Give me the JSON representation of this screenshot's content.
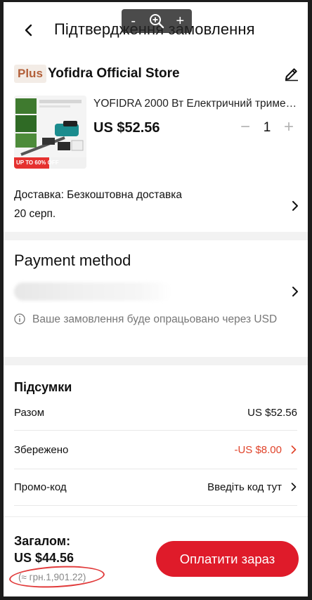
{
  "header": {
    "title": "Підтвердження замовлення",
    "zoom": {
      "zoom_out": "-",
      "zoom_in": "+"
    }
  },
  "store": {
    "badge": "Plus",
    "name": "Yofidra Official Store"
  },
  "product": {
    "title": "YOFIDRA 2000 Вт Електричний тример ...",
    "price": "US $52.56",
    "quantity": "1",
    "image_badge": "UP TO 60% OFF",
    "image_badge_highlight": "60"
  },
  "delivery": {
    "label": "Доставка: Безкоштовна доставка",
    "date": "20 серп."
  },
  "payment": {
    "title": "Payment method",
    "note": "Ваше замовлення буде опрацьовано через USD"
  },
  "summary": {
    "title": "Підсумки",
    "rows": [
      {
        "label": "Разом",
        "value": "US $52.56"
      },
      {
        "label": "Збережено",
        "value": "-US $8.00"
      },
      {
        "label": "Промо-код",
        "value": "Введіть код тут"
      }
    ]
  },
  "footer": {
    "total_label": "Загалом:",
    "total_value": "US $44.56",
    "total_uah": "(≈ грн.1,901.22)",
    "pay_button": "Оплатити зараз"
  },
  "colors": {
    "accent_red": "#df1b2a",
    "saved_red": "#e0432a",
    "plus_badge_text": "#b3603a",
    "annotation_circle": "#e13a3a"
  }
}
